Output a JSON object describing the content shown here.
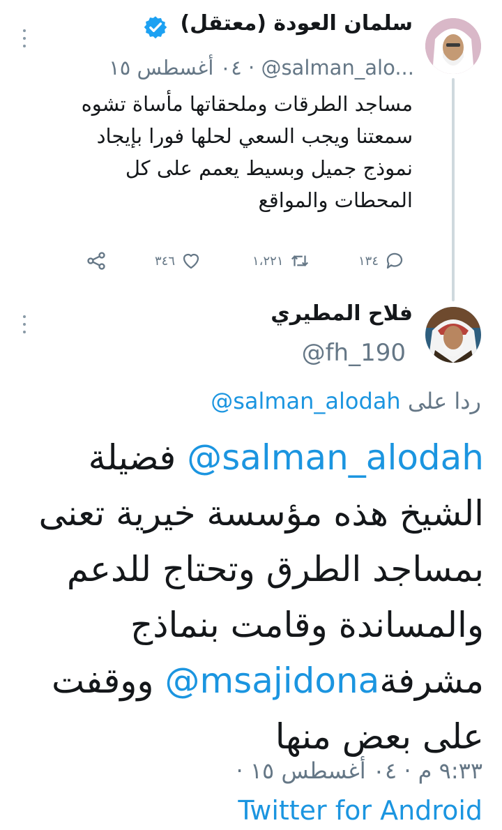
{
  "quoted_tweet": {
    "display_name": "سلمان العودة (معتقل)",
    "handle": "@salman_alo...",
    "meta_separator": "·",
    "date": "٠٤ أغسطس ١٥",
    "text": "مساجد الطرقات وملحقاتها مأساة تشوه سمعتنا ويجب السعي لحلها فورا بإيجاد نموذج جميل وبسيط يعمم على كل المحطات والمواقع",
    "replies": "١٣٤",
    "retweets": "١،٢٢١",
    "likes": "٣٤٦",
    "icons": [
      "verified-icon",
      "reply-icon",
      "retweet-icon",
      "like-icon",
      "share-icon",
      "more-icon"
    ]
  },
  "main_tweet": {
    "display_name": "فلاح المطيري",
    "handle": "@fh_190",
    "reply_prefix": "ردا على",
    "reply_to": "@salman_alodah",
    "text_parts": {
      "mention1": "@salman_alodah",
      "part1": " فضيلة الشيخ هذه مؤسسة خيرية تعنى بمساجد الطرق وتحتاج للدعم والمساندة وقامت بنماذج مشرفة",
      "mention2": "@msajidona",
      "part2": " ووقفت على بعض منها"
    },
    "timestamp": "٩:٣٣ م · ٠٤ أغسطس ١٥ ·",
    "source": "Twitter for Android"
  },
  "colors": {
    "link": "#1b95e0",
    "muted": "#657786",
    "verified": "#1da1f2",
    "thread_line": "#cfd9de"
  }
}
